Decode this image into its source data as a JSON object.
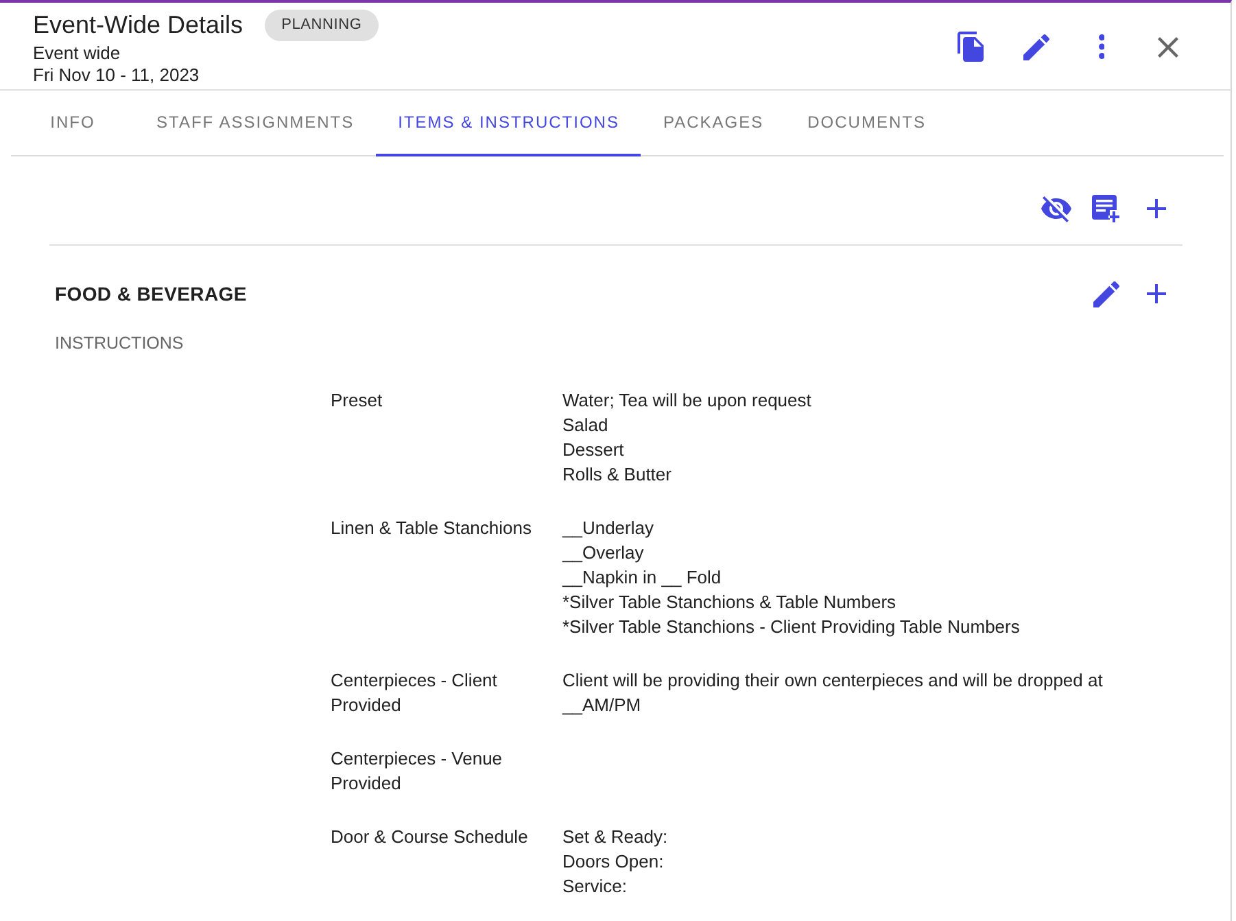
{
  "window": {
    "title": "Event-Wide Details",
    "status": "PLANNING",
    "subtitle": "Event wide",
    "date": "Fri Nov 10 - 11, 2023"
  },
  "tabs": [
    {
      "label": "INFO",
      "selected": false
    },
    {
      "label": "STAFF ASSIGNMENTS",
      "selected": false
    },
    {
      "label": "ITEMS & INSTRUCTIONS",
      "selected": true
    },
    {
      "label": "PACKAGES",
      "selected": false
    },
    {
      "label": "DOCUMENTS",
      "selected": false
    }
  ],
  "section": {
    "title": "FOOD & BEVERAGE",
    "subtitle": "INSTRUCTIONS",
    "instructions": [
      {
        "label": "Preset",
        "lines": [
          "Water; Tea will be upon request",
          "Salad",
          "Dessert",
          "Rolls & Butter"
        ]
      },
      {
        "label": "Linen & Table Stanchions",
        "lines": [
          "__Underlay",
          "__Overlay",
          "__Napkin in __ Fold",
          "*Silver Table Stanchions & Table Numbers",
          "*Silver Table Stanchions - Client Providing Table Numbers"
        ]
      },
      {
        "label": "Centerpieces - Client Provided",
        "lines": [
          "Client will be providing their own centerpieces and will be dropped at __AM/PM"
        ]
      },
      {
        "label": "Centerpieces - Venue Provided"
      },
      {
        "label": "Door & Course Schedule",
        "lines": [
          "Set & Ready:",
          "Doors Open:",
          "Service:"
        ]
      }
    ]
  }
}
